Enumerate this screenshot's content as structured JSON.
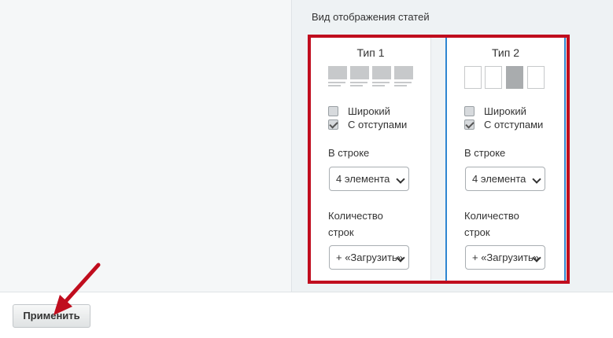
{
  "section_title": "Вид отображения статей",
  "types": [
    {
      "title": "Тип 1",
      "wide_label": "Широкий",
      "wide_checked": false,
      "padding_label": "С отступами",
      "padding_checked": true,
      "per_row_label": "В строке",
      "per_row_value": "4 элемента",
      "rows_label_line1": "Количество",
      "rows_label_line2": "строк",
      "rows_value": "+ «Загрузить»"
    },
    {
      "title": "Тип 2",
      "wide_label": "Широкий",
      "wide_checked": false,
      "padding_label": "С отступами",
      "padding_checked": true,
      "per_row_label": "В строке",
      "per_row_value": "4 элемента",
      "rows_label_line1": "Количество",
      "rows_label_line2": "строк",
      "rows_value": "+ «Загрузить»"
    }
  ],
  "footer": {
    "apply_label": "Применить"
  },
  "colors": {
    "highlight": "#c00d1e",
    "selected_border": "#2f86d1",
    "arrow": "#c00d1e"
  },
  "icons": [
    "chevron-down-icon",
    "annotation-arrow-icon"
  ]
}
